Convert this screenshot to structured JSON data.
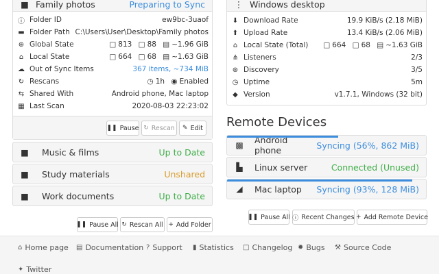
{
  "left_panel": {
    "title": "Family photos",
    "status": "Preparing to Sync",
    "rows": [
      {
        "icon": "info-icon",
        "glyph": "ℹ",
        "label": "Folder ID",
        "value": "ew9bc-3uaof"
      },
      {
        "icon": "folder-icon",
        "glyph": "▬",
        "label": "Folder Path",
        "value": "C:\\Users\\User\\Desktop\\Family photos"
      },
      {
        "icon": "globe-icon",
        "glyph": "⊕",
        "label": "Global State",
        "files": "813",
        "dirs": "88",
        "size": "~1.96 GiB"
      },
      {
        "icon": "home-icon",
        "glyph": "⌂",
        "label": "Local State",
        "files": "664",
        "dirs": "68",
        "size": "~1.63 GiB"
      },
      {
        "icon": "cloud-upload-icon",
        "glyph": "☁",
        "label": "Out of Sync Items",
        "value": "367 items, ~734 MiB"
      },
      {
        "icon": "refresh-icon",
        "glyph": "↻",
        "label": "Rescans",
        "rescan_interval": "1h",
        "watch": "Enabled"
      },
      {
        "icon": "share-icon",
        "glyph": "⇆",
        "label": "Shared With",
        "value": "Android phone, Mac laptop"
      },
      {
        "icon": "calendar-icon",
        "glyph": "▦",
        "label": "Last Scan",
        "value": "2020-08-03 22:23:02"
      }
    ],
    "buttons": {
      "pause": "Pause",
      "rescan": "Rescan",
      "edit": "Edit"
    }
  },
  "folders": [
    {
      "name": "Music & films",
      "status": "Up to Date",
      "color": "#3fae49"
    },
    {
      "name": "Study materials",
      "status": "Unshared",
      "color": "#d99b2b"
    },
    {
      "name": "Work documents",
      "status": "Up to Date",
      "color": "#3fae49"
    }
  ],
  "folder_actions": {
    "pause_all": "Pause All",
    "rescan_all": "Rescan All",
    "add_folder": "Add Folder"
  },
  "right_panel": {
    "title": "Windows desktop",
    "rows": [
      {
        "icon": "download-icon",
        "glyph": "⬇",
        "label": "Download Rate",
        "value": "19.9 KiB/s (2.18 MiB)"
      },
      {
        "icon": "upload-icon",
        "glyph": "⬆",
        "label": "Upload Rate",
        "value": "13.4 KiB/s (2.06 MiB)"
      },
      {
        "icon": "home-icon",
        "glyph": "⌂",
        "label": "Local State (Total)",
        "files": "664",
        "dirs": "68",
        "size": "~1.63 GiB"
      },
      {
        "icon": "network-icon",
        "glyph": "⋔",
        "label": "Listeners",
        "value": "2/3"
      },
      {
        "icon": "discovery-icon",
        "glyph": "⊛",
        "label": "Discovery",
        "value": "3/5"
      },
      {
        "icon": "clock-icon",
        "glyph": "◷",
        "label": "Uptime",
        "value": "5m"
      },
      {
        "icon": "tag-icon",
        "glyph": "◆",
        "label": "Version",
        "value": "v1.7.1, Windows (32 bit)"
      }
    ]
  },
  "remote_devices": {
    "heading": "Remote Devices",
    "devices": [
      {
        "name": "Android phone",
        "status": "Syncing (56%, 862 MiB)",
        "progress": 0.56,
        "color": "#3c8dde"
      },
      {
        "name": "Linux server",
        "status": "Connected (Unused)",
        "progress": 0,
        "color": "#3fae49"
      },
      {
        "name": "Mac laptop",
        "status": "Syncing (93%, 128 MiB)",
        "progress": 0.93,
        "color": "#3c8dde"
      }
    ],
    "actions": {
      "pause_all": "Pause All",
      "recent_changes": "Recent Changes",
      "add_device": "Add Remote Device"
    }
  },
  "footer": {
    "home": "Home page",
    "docs": "Documentation",
    "support": "Support",
    "stats": "Statistics",
    "changelog": "Changelog",
    "bugs": "Bugs",
    "source": "Source Code",
    "twitter": "Twitter"
  }
}
